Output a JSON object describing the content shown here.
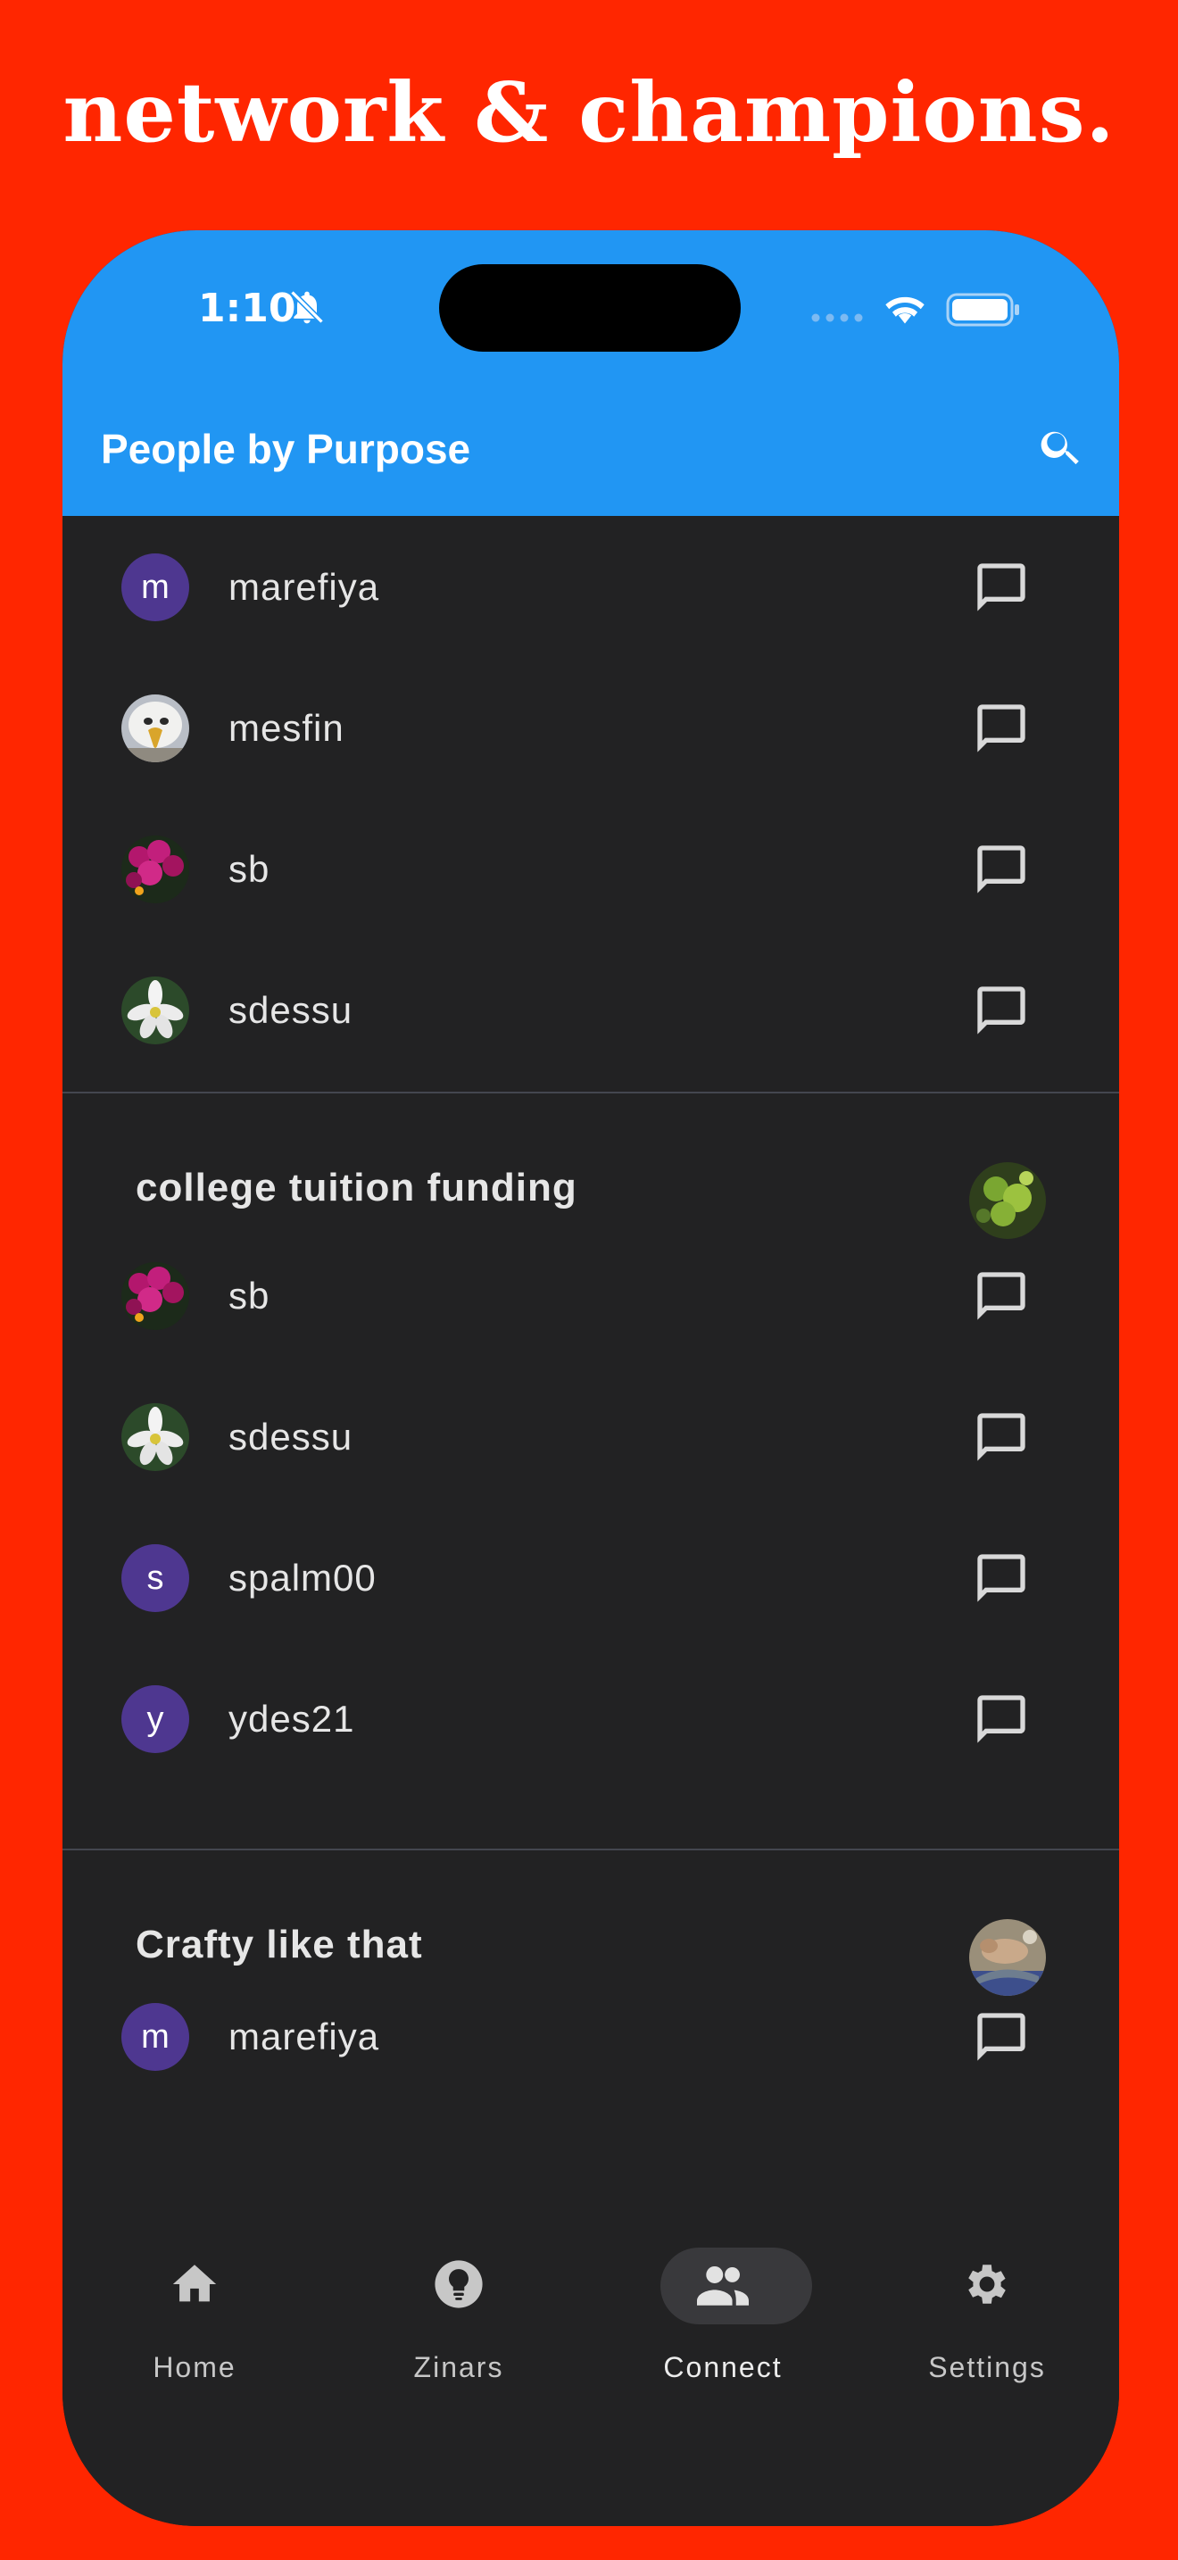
{
  "headline": "network & champions.",
  "status_bar": {
    "time": "1:10"
  },
  "app_bar": {
    "title": "People by Purpose"
  },
  "top_list": [
    {
      "name": "marefiya",
      "avatar_letter": "m",
      "avatar_type": "letter"
    },
    {
      "name": "mesfin",
      "avatar_type": "photo-eagle"
    },
    {
      "name": "sb",
      "avatar_type": "photo-pink-flowers"
    },
    {
      "name": "sdessu",
      "avatar_type": "photo-white-flower"
    }
  ],
  "sections": [
    {
      "title": "college tuition funding",
      "members": [
        {
          "name": "sb",
          "avatar_type": "photo-pink-flowers"
        },
        {
          "name": "sdessu",
          "avatar_type": "photo-white-flower"
        },
        {
          "name": "spalm00",
          "avatar_letter": "s",
          "avatar_type": "letter"
        },
        {
          "name": "ydes21",
          "avatar_letter": "y",
          "avatar_type": "letter"
        }
      ]
    },
    {
      "title": "Crafty like that",
      "members": [
        {
          "name": "marefiya",
          "avatar_letter": "m",
          "avatar_type": "letter"
        }
      ]
    }
  ],
  "bottom_nav": [
    {
      "label": "Home",
      "icon": "home-icon",
      "active": false
    },
    {
      "label": "Zinars",
      "icon": "lightbulb-icon",
      "active": false
    },
    {
      "label": "Connect",
      "icon": "people-icon",
      "active": true
    },
    {
      "label": "Settings",
      "icon": "gear-icon",
      "active": false
    }
  ],
  "colors": {
    "background": "#ff2600",
    "app_bar": "#2196f3",
    "surface": "#222223",
    "avatar_letter_bg": "#4e3790"
  }
}
